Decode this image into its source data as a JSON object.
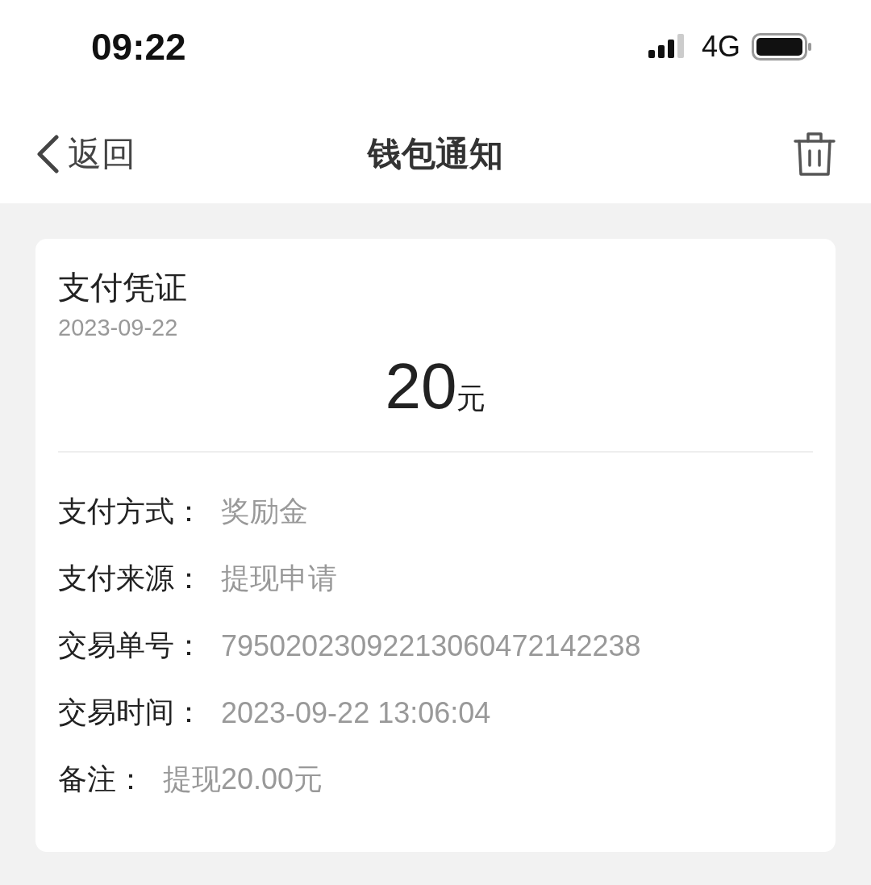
{
  "status_bar": {
    "time": "09:22",
    "network": "4G"
  },
  "nav": {
    "back": "返回",
    "title": "钱包通知"
  },
  "card": {
    "title": "支付凭证",
    "date": "2023-09-22",
    "amount": "20",
    "unit": "元",
    "rows": [
      {
        "label": "支付方式：",
        "value": "奖励金"
      },
      {
        "label": "支付来源：",
        "value": "提现申请"
      },
      {
        "label": "交易单号：",
        "value": "79502023092213060472142238"
      },
      {
        "label": "交易时间：",
        "value": "2023-09-22 13:06:04"
      },
      {
        "label": "备注：",
        "value": "提现20.00元"
      }
    ]
  }
}
